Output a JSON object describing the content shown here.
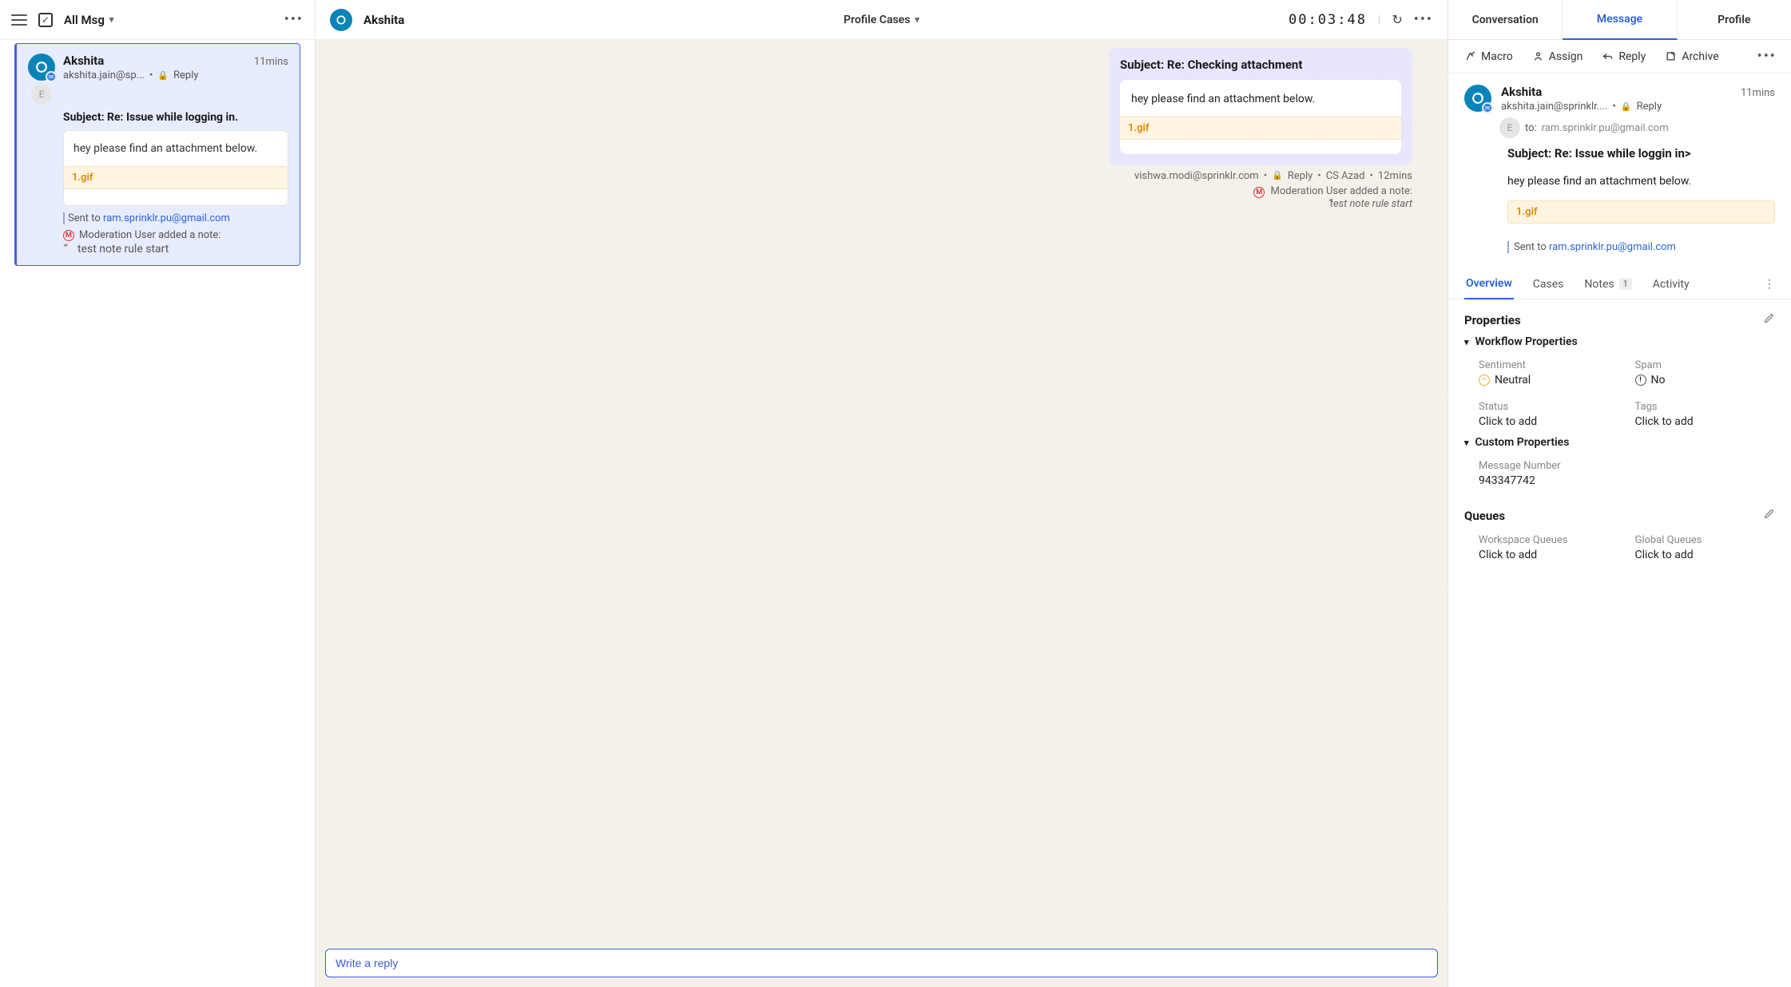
{
  "left": {
    "filter_label": "All Msg",
    "conversation": {
      "name": "Akshita",
      "email": "akshita.jain@sp...",
      "badge": "Reply",
      "time": "11mins",
      "avatar_sub_letter": "E",
      "subject": "Subject: Re: Issue while logging in.",
      "body": "hey please find an attachment below.",
      "attachment": "1.gif",
      "sent_to_prefix": "Sent to ",
      "sent_to": "ram.sprinklr.pu@gmail.com",
      "note_label": "Moderation User added a note:",
      "note_text": "test note rule start"
    }
  },
  "center": {
    "name": "Akshita",
    "title": "Profile Cases",
    "timer": "00:03:48",
    "bubble": {
      "subject": "Subject: Re: Checking attachment",
      "body": "hey please find an attachment below.",
      "attachment": "1.gif",
      "meta_email": "vishwa.modi@sprinklr.com",
      "meta_reply": "Reply",
      "meta_user": "CS Azad",
      "meta_time": "12mins",
      "note_label": "Moderation User added a note:",
      "note_text": "test note rule start"
    },
    "reply_placeholder": "Write a reply"
  },
  "right": {
    "tabs": {
      "conversation": "Conversation",
      "message": "Message",
      "profile": "Profile"
    },
    "toolbar": {
      "macro": "Macro",
      "assign": "Assign",
      "reply": "Reply",
      "archive": "Archive"
    },
    "detail": {
      "name": "Akshita",
      "email": "akshita.jain@sprinklr....",
      "badge": "Reply",
      "time": "11mins",
      "to_label": "to:",
      "to_email": "ram.sprinklr.pu@gmail.com",
      "avatar_sub_letter": "E",
      "subject": "Subject: Re: Issue while loggin in>",
      "body": "hey please find an attachment below.",
      "attachment": "1.gif",
      "sent_to_prefix": "Sent to ",
      "sent_to": "ram.sprinklr.pu@gmail.com"
    },
    "subtabs": {
      "overview": "Overview",
      "cases": "Cases",
      "notes": "Notes",
      "notes_count": "1",
      "activity": "Activity"
    },
    "properties": {
      "title": "Properties",
      "workflow_title": "Workflow Properties",
      "sentiment_label": "Sentiment",
      "sentiment_value": "Neutral",
      "spam_label": "Spam",
      "spam_value": "No",
      "status_label": "Status",
      "status_value": "Click to add",
      "tags_label": "Tags",
      "tags_value": "Click to add",
      "custom_title": "Custom Properties",
      "msgnum_label": "Message Number",
      "msgnum_value": "943347742"
    },
    "queues": {
      "title": "Queues",
      "workspace_label": "Workspace Queues",
      "workspace_value": "Click to add",
      "global_label": "Global Queues",
      "global_value": "Click to add"
    }
  }
}
